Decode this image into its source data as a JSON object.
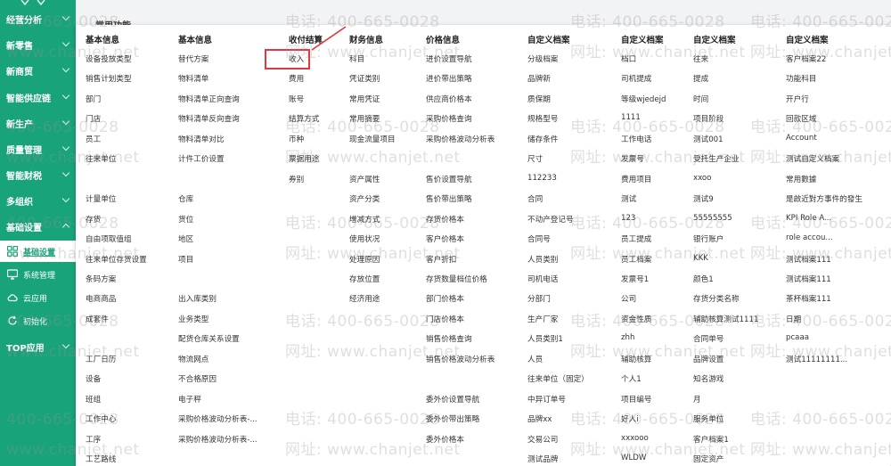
{
  "sidebar": {
    "items": [
      {
        "label": "经营分析",
        "state": "collapsed"
      },
      {
        "label": "新零售",
        "state": "collapsed"
      },
      {
        "label": "新商贸",
        "state": "collapsed"
      },
      {
        "label": "智能供应链",
        "state": "collapsed"
      },
      {
        "label": "新生产",
        "state": "collapsed"
      },
      {
        "label": "质量管理",
        "state": "collapsed"
      },
      {
        "label": "智能财税",
        "state": "collapsed"
      },
      {
        "label": "多组织",
        "state": "collapsed"
      },
      {
        "label": "基础设置",
        "state": "expanded"
      }
    ],
    "sub_items": [
      {
        "label": "基础设置",
        "icon": "grid-icon",
        "active": true
      },
      {
        "label": "系统管理",
        "icon": "monitor-icon",
        "active": false
      },
      {
        "label": "云应用",
        "icon": "cloud-icon",
        "active": false
      },
      {
        "label": "初始化",
        "icon": "refresh-icon",
        "active": false
      }
    ],
    "top_item": {
      "label": "TOP应用"
    }
  },
  "main": {
    "tab_title": "常用功能",
    "columns": [
      {
        "title": "基本信息",
        "links": [
          "设备投放类型",
          "销售计划类型",
          "部门",
          "门店",
          "员工",
          "往来单位",
          "",
          "计量单位",
          "存货",
          "自由项取值组",
          "往来单位存货设置",
          "条码方案",
          "电商商品",
          "成套件",
          "",
          "工厂日历",
          "设备",
          "班组",
          "工作中心",
          "工序",
          "工艺路线"
        ]
      },
      {
        "title": "基本信息",
        "links": [
          "替代方案",
          "物料清单",
          "物料清单正向查询",
          "物料清单反向查询",
          "物料清单对比",
          "计件工价设置",
          "",
          "仓库",
          "货位",
          "地区",
          "项目",
          "",
          "出入库类别",
          "业务类型",
          "配货仓库关系设置",
          "物流网点",
          "不合格原因",
          "电子秤",
          "采购价格波动分析表-...",
          "采购价格波动分析表-..."
        ]
      },
      {
        "title": "收付结算",
        "links": [
          "收入",
          "费用",
          "账号",
          "结算方式",
          "币种",
          "票据用途",
          "券别"
        ]
      },
      {
        "title": "财务信息",
        "links": [
          "科目",
          "凭证类别",
          "常用凭证",
          "常用摘要",
          "现金流量项目",
          "",
          "资产属性",
          "资产分类",
          "增减方式",
          "使用状况",
          "处理原因",
          "存放位置",
          "经济用途"
        ]
      },
      {
        "title": "价格信息",
        "links": [
          "进价设置导航",
          "进价带出策略",
          "供应商价格本",
          "采购价格查询",
          "采购价格波动分析表",
          "",
          "售价设置导航",
          "售价带出策略",
          "存货价格本",
          "客户价格本",
          "客户折扣",
          "存货数量档位价格",
          "部门价格本",
          "门店价格本",
          "销售价格查询",
          "销售价格波动分析表",
          "",
          "委外价设置导航",
          "委外价带出策略",
          "委外价格本"
        ]
      },
      {
        "title": "自定义档案",
        "links": [
          "分级档案",
          "品牌新",
          "质保期",
          "规格型号",
          "储存条件",
          "尺寸",
          "112233",
          "合同",
          "不动产登记号",
          "合同号",
          "人员类别",
          "司机电话",
          "分部门",
          "生产厂家",
          "人员类别1",
          "人员",
          "往来单位（固定）",
          "中异订单号",
          "品牌xx",
          "交易公司",
          "测试品牌"
        ]
      },
      {
        "title": "自定义档案",
        "links": [
          "档口",
          "司机提成",
          "等级wjedejd",
          "1111",
          "工作电话",
          "发票号",
          "费用项目",
          "测试",
          "123",
          "员工提成",
          "员工档案",
          "发票号1",
          "公司",
          "资金性质",
          "zhh",
          "辅助核算",
          "个人1",
          "项目编号",
          "好人i",
          "xxxooo",
          "WLDW"
        ]
      },
      {
        "title": "自定义档案",
        "links": [
          "往来",
          "提成",
          "时间",
          "项目阶段",
          "测试001",
          "受托生产企业",
          "xxoo",
          "测试9",
          "55555555",
          "银行账户",
          "KKK",
          "颜色1",
          "存货分类名称",
          "辅助核算测试1111",
          "合同单号",
          "品牌设置",
          "知名游戏",
          "月",
          "服务单位",
          "客户档案1",
          "固定资产"
        ]
      },
      {
        "title": "自定义档案",
        "links": [
          "客户档案22",
          "功能科目",
          "开户行",
          "回款区域",
          "Account",
          "测试自定义档案",
          "常用數據",
          "是啟近對方事件的發生",
          "KPI Role A...",
          "role accou...",
          "测试档案111",
          "测试档案111",
          "茶杯档案111",
          "日期",
          "pcaaa",
          "测试11111111..."
        ]
      }
    ],
    "highlighted_link": "科目"
  },
  "watermarks": {
    "phone": "电话: 400-665-0028",
    "site": "网址: www.chanjet.net"
  },
  "colors": {
    "sidebar_bg": "#18a37b",
    "highlight": "#e0383e",
    "panel_bg": "#ffffff"
  }
}
